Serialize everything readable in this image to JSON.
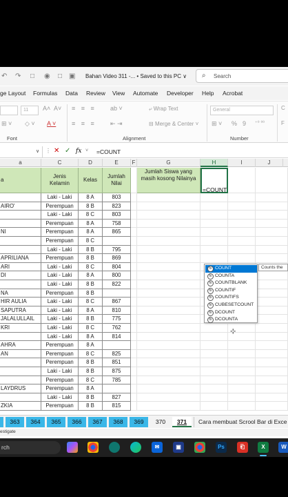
{
  "titlebar": {
    "title": "Bahan Video 311 -...  •  Saved to this PC ∨",
    "search_placeholder": "Search",
    "qa_icons": [
      "↶",
      "↷",
      "□",
      "◉",
      "□",
      "▣",
      "▥"
    ]
  },
  "menu": [
    "ge Layout",
    "Formulas",
    "Data",
    "Review",
    "View",
    "Automate",
    "Developer",
    "Help",
    "Acrobat"
  ],
  "ribbon": {
    "font_size": "11",
    "wrap_text": "Wrap Text",
    "merge_center": "Merge & Center",
    "number_format": "General",
    "percent": "%",
    "comma": "9",
    "group_font": "Font",
    "group_alignment": "Alignment",
    "group_number": "Number"
  },
  "formula_bar": {
    "formula": "=COUNT"
  },
  "columns": [
    "a",
    "C",
    "D",
    "E",
    "F",
    "G",
    "H",
    "I",
    "J"
  ],
  "headers": {
    "nama": "a",
    "jenis": "Jenis Kelamin",
    "kelas": "Kelas",
    "nilai": "Jumlah Nilai",
    "g_header": "Jumlah Siswa yang masih kosong Nilainya",
    "h_input": "=COUNT"
  },
  "rows": [
    {
      "name": "",
      "gender": "Laki - Laki",
      "kelas": "8 A",
      "nilai": "803"
    },
    {
      "name": "AIRO'",
      "gender": "Perempuan",
      "kelas": "8 B",
      "nilai": "823"
    },
    {
      "name": "",
      "gender": "Laki - Laki",
      "kelas": "8 C",
      "nilai": "803"
    },
    {
      "name": "",
      "gender": "Perempuan",
      "kelas": "8 A",
      "nilai": "758"
    },
    {
      "name": "NI",
      "gender": "Perempuan",
      "kelas": "8 A",
      "nilai": "865"
    },
    {
      "name": "",
      "gender": "Perempuan",
      "kelas": "8 C",
      "nilai": ""
    },
    {
      "name": "",
      "gender": "Laki - Laki",
      "kelas": "8 B",
      "nilai": "795"
    },
    {
      "name": "APRILIANA",
      "gender": "Perempuan",
      "kelas": "8 B",
      "nilai": "869"
    },
    {
      "name": "ARI",
      "gender": "Laki - Laki",
      "kelas": "8 C",
      "nilai": "804"
    },
    {
      "name": "DI",
      "gender": "Laki - Laki",
      "kelas": "8 A",
      "nilai": "800"
    },
    {
      "name": "",
      "gender": "Laki - Laki",
      "kelas": "8 B",
      "nilai": "822"
    },
    {
      "name": "NA",
      "gender": "Perempuan",
      "kelas": "8 B",
      "nilai": ""
    },
    {
      "name": "HIR AULIA",
      "gender": "Laki - Laki",
      "kelas": "8 C",
      "nilai": "867"
    },
    {
      "name": "SAPUTRA",
      "gender": "Laki - Laki",
      "kelas": "8 A",
      "nilai": "810"
    },
    {
      "name": "JALALULLAIL",
      "gender": "Laki - Laki",
      "kelas": "8 B",
      "nilai": "775"
    },
    {
      "name": "KRI",
      "gender": "Laki - Laki",
      "kelas": "8 C",
      "nilai": "762"
    },
    {
      "name": "",
      "gender": "Laki - Laki",
      "kelas": "8 A",
      "nilai": "814"
    },
    {
      "name": "AHRA",
      "gender": "Perempuan",
      "kelas": "8 A",
      "nilai": ""
    },
    {
      "name": "AN",
      "gender": "Perempuan",
      "kelas": "8 C",
      "nilai": "825"
    },
    {
      "name": "",
      "gender": "Perempuan",
      "kelas": "8 B",
      "nilai": "851"
    },
    {
      "name": "",
      "gender": "Laki - Laki",
      "kelas": "8 B",
      "nilai": "875"
    },
    {
      "name": "",
      "gender": "Perempuan",
      "kelas": "8 C",
      "nilai": "785"
    },
    {
      "name": "LAYDRUS",
      "gender": "Perempuan",
      "kelas": "8 A",
      "nilai": ""
    },
    {
      "name": "",
      "gender": "Laki - Laki",
      "kelas": "8 B",
      "nilai": "827"
    },
    {
      "name": "ZKIA",
      "gender": "Perempuan",
      "kelas": "8 B",
      "nilai": "815"
    }
  ],
  "autocomplete": {
    "items": [
      "COUNT",
      "COUNTA",
      "COUNTBLANK",
      "COUNTIF",
      "COUNTIFS",
      "CUBESETCOUNT",
      "DCOUNT",
      "DCOUNTA"
    ],
    "tooltip": "Counts the"
  },
  "sheet_tabs": {
    "cyan": [
      "",
      "363",
      "364",
      "365",
      "366",
      "367",
      "368",
      "369"
    ],
    "plain": "370",
    "active": "371",
    "long": "Cara membuat Scrool Bar di Exce"
  },
  "status": "estigate",
  "taskbar": {
    "search_label": "rch",
    "icons": [
      "Co",
      "Ch",
      "Ed",
      "Mail",
      "Ch",
      "Ps",
      "Ac",
      "X",
      "W"
    ]
  },
  "colors": {
    "header_green": "#cfe7b8",
    "excel_green": "#217346",
    "tab_cyan": "#3ab7e8",
    "select_blue": "#0078d4"
  }
}
